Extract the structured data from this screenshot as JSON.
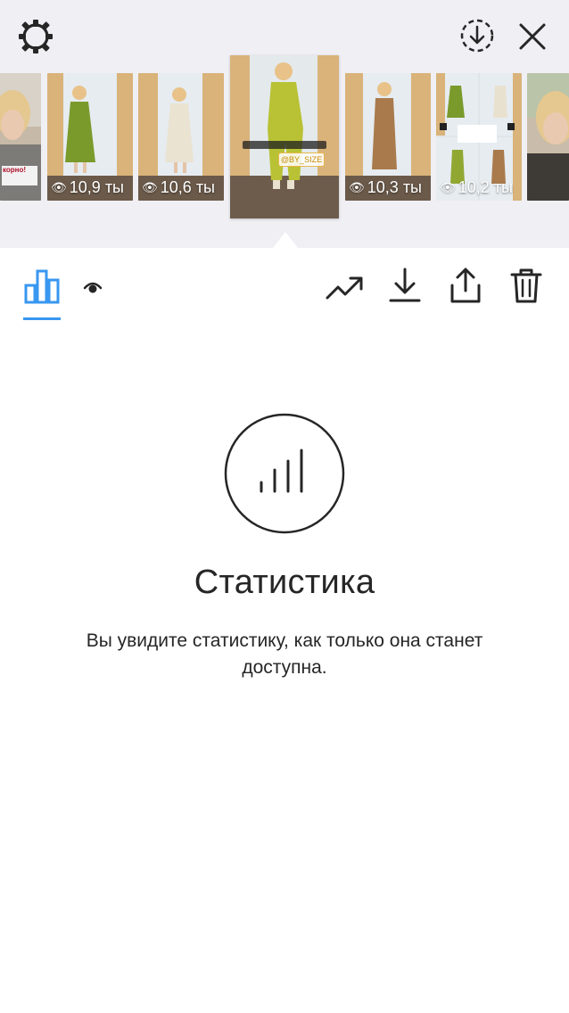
{
  "header": {
    "settings_icon": "gear-icon",
    "save_icon": "download-circle-icon",
    "close_icon": "close-icon"
  },
  "thumbnails": [
    {
      "views": "",
      "tone": "#c7b9a8",
      "person": "blonde-woman-selfie",
      "text": "корно!"
    },
    {
      "views": "10,9 ты",
      "tone": "#d7c49a",
      "dress": "#7a9a2c"
    },
    {
      "views": "10,6 ты",
      "tone": "#d8c49c",
      "dress": "#e9e1cf"
    },
    {
      "views": "10,3 ты",
      "tone": "#c9b89a",
      "dress": "#a87a4c"
    },
    {
      "views": "10,2 ты",
      "tone": "#d3c2a4",
      "dress": "#90a832"
    },
    {
      "views": "",
      "tone": "#c9bcaa",
      "person": "blonde-woman-selfie"
    }
  ],
  "selected_thumbnail": {
    "sticker_text": "@BY_SIZE",
    "dress": "#b8c234"
  },
  "toolbar": {
    "stats_tab_icon": "bar-chart-icon",
    "viewers_tab_icon": "eye-icon",
    "promote_icon": "trending-up-icon",
    "download_icon": "download-icon",
    "share_icon": "share-icon",
    "delete_icon": "trash-icon",
    "accent": "#3897f0"
  },
  "empty_state": {
    "title": "Статистика",
    "message": "Вы увидите статистику, как только она станет доступна."
  }
}
